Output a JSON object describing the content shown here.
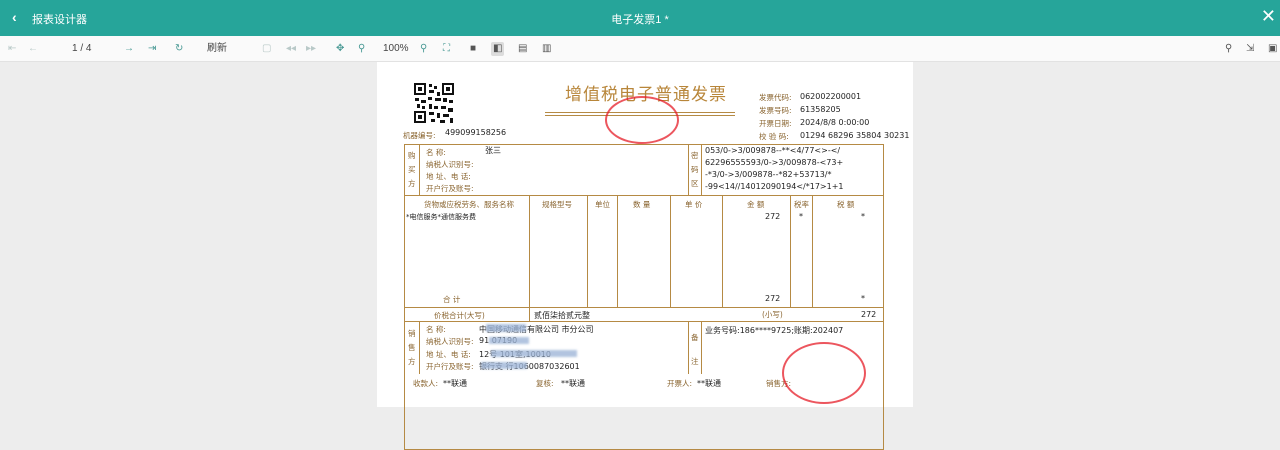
{
  "titlebar": {
    "back_icon": "‹",
    "app_title": "报表设计器",
    "doc_title": "电子发票1 *",
    "close_icon": "✕"
  },
  "toolbar": {
    "page_indicator": "1 / 4",
    "refresh_label": "刷新",
    "zoom": "100%"
  },
  "invoice": {
    "title": "增值税电子普通发票",
    "machine_no_label": "机器编号:",
    "machine_no": "499099158256",
    "code_label": "发票代码:",
    "code": "062002200001",
    "number_label": "发票号码:",
    "number": "61358205",
    "date_label": "开票日期:",
    "date": "2024/8/8 0:00:00",
    "check_label": "校 验 码:",
    "check_code": "01294 68296 35804 30231",
    "buyer_side": [
      "购",
      "买",
      "方"
    ],
    "buyer_name_label": "名        称:",
    "buyer_name": "张三",
    "buyer_taxid_label": "纳税人识别号:",
    "buyer_addr_label": "地 址、电 话:",
    "buyer_bank_label": "开户行及账号:",
    "cipher_side": [
      "密",
      "码",
      "区"
    ],
    "cipher_lines": [
      "053/0->3/009878--**<4/77<>-</",
      "62296555593/0->3/009878-<73+",
      "-*3/0->3/009878--*82+53713/*",
      "-99<14//14012090194</*17>1+1"
    ],
    "col_item": "货物或应税劳务、服务名称",
    "col_spec": "规格型号",
    "col_unit": "单位",
    "col_qty": "数  量",
    "col_price": "单  价",
    "col_amount": "金  额",
    "col_rate": "税率",
    "col_tax": "税  额",
    "item_name": "*电信服务*通信服务费",
    "item_amount": "272",
    "item_rate": "*",
    "item_tax": "*",
    "sum_label": "合        计",
    "sum_amount": "272",
    "sum_tax": "*",
    "total_label": "价税合计(大写)",
    "total_words": "贰佰柒拾贰元整",
    "small_label": "(小写)",
    "total_small": "272",
    "seller_side": [
      "销",
      "售",
      "方"
    ],
    "seller_name_label": "名        称:",
    "seller_name": "中国移动通信有限公司  市分公司",
    "seller_taxid_label": "纳税人识别号:",
    "seller_taxid": "91    07190",
    "seller_addr_label": "地 址、电 话:",
    "seller_addr": "          12号   101室,10010",
    "seller_bank_label": "开户行及账号:",
    "seller_bank": "   银行支     行1060087032601",
    "remark_side": [
      "备",
      "注"
    ],
    "remark": "业务号码:186****9725;账期:202407",
    "payee_label": "收款人:",
    "payee": "**联通",
    "reviewer_label": "复核:",
    "reviewer": "**联通",
    "drawer_label": "开票人:",
    "drawer": "**联通",
    "seller_sign_label": "销售方:"
  }
}
